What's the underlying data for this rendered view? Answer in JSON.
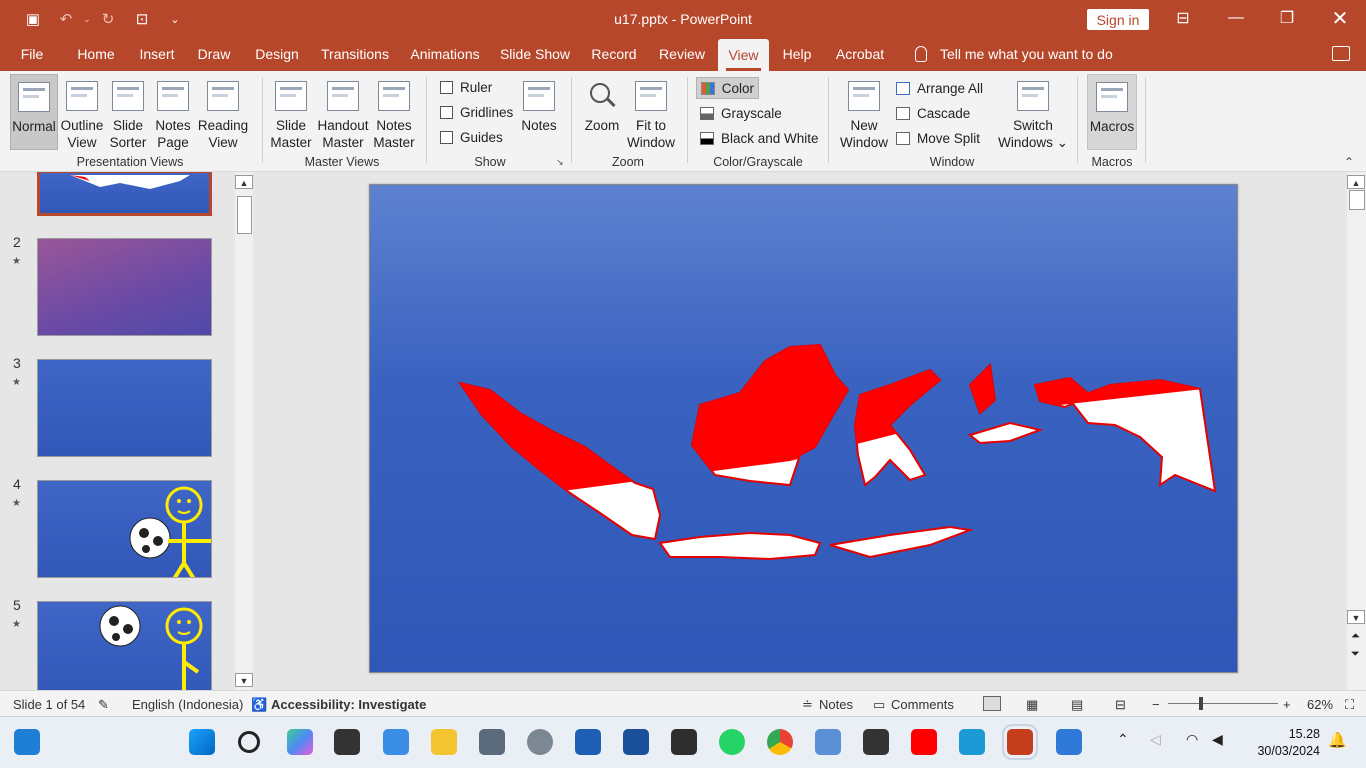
{
  "app": {
    "title": "u17.pptx  -  PowerPoint",
    "sign_in": "Sign in"
  },
  "tabs": [
    "File",
    "Home",
    "Insert",
    "Draw",
    "Design",
    "Transitions",
    "Animations",
    "Slide Show",
    "Record",
    "Review",
    "View",
    "Help",
    "Acrobat"
  ],
  "active_tab": "View",
  "tell_me": "Tell me what you want to do",
  "ribbon": {
    "presentation_views": {
      "label": "Presentation Views",
      "normal": "Normal",
      "outline": [
        "Outline",
        "View"
      ],
      "sorter": [
        "Slide",
        "Sorter"
      ],
      "notes_page": [
        "Notes",
        "Page"
      ],
      "reading": [
        "Reading",
        "View"
      ]
    },
    "master_views": {
      "label": "Master Views",
      "slide_master": [
        "Slide",
        "Master"
      ],
      "handout_master": [
        "Handout",
        "Master"
      ],
      "notes_master": [
        "Notes",
        "Master"
      ]
    },
    "show": {
      "label": "Show",
      "ruler": "Ruler",
      "gridlines": "Gridlines",
      "guides": "Guides",
      "notes": "Notes"
    },
    "zoom": {
      "label": "Zoom",
      "zoom": "Zoom",
      "fit": [
        "Fit to",
        "Window"
      ]
    },
    "color": {
      "label": "Color/Grayscale",
      "color": "Color",
      "grayscale": "Grayscale",
      "bw": "Black and White"
    },
    "window": {
      "label": "Window",
      "new_window": [
        "New",
        "Window"
      ],
      "arrange_all": "Arrange All",
      "cascade": "Cascade",
      "move_split": "Move Split",
      "switch": [
        "Switch",
        "Windows ⌄"
      ]
    },
    "macros": {
      "label": "Macros",
      "macros": "Macros"
    }
  },
  "thumbnails": [
    {
      "num": "2"
    },
    {
      "num": "3"
    },
    {
      "num": "4"
    },
    {
      "num": "5"
    }
  ],
  "status": {
    "slide": "Slide 1 of 54",
    "language": "English (Indonesia)",
    "accessibility": "Accessibility: Investigate",
    "notes": "Notes",
    "comments": "Comments",
    "zoom": "62%"
  },
  "clock": {
    "time": "15.28",
    "date": "30/03/2024"
  },
  "colors": {
    "accent": "#b7472a",
    "slide_bg": "#3a62c0",
    "flag_red": "#ff0000"
  }
}
